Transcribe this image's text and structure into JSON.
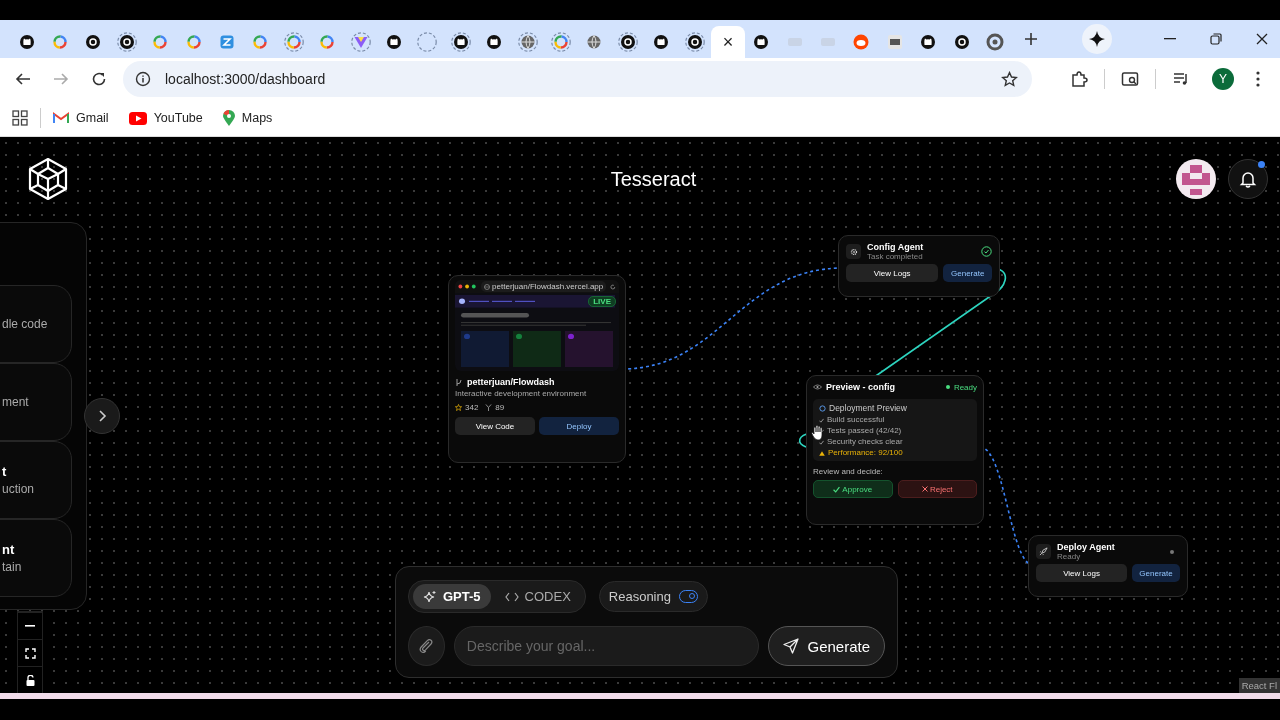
{
  "browser": {
    "tabs": [
      {
        "kind": "github",
        "selected": false,
        "loading": false
      },
      {
        "kind": "google",
        "selected": false,
        "loading": false
      },
      {
        "kind": "dark",
        "selected": false,
        "loading": false
      },
      {
        "kind": "dark",
        "selected": false,
        "loading": true
      },
      {
        "kind": "google",
        "selected": false,
        "loading": false
      },
      {
        "kind": "google",
        "selected": false,
        "loading": false
      },
      {
        "kind": "zed",
        "selected": false,
        "loading": false
      },
      {
        "kind": "google",
        "selected": false,
        "loading": false
      },
      {
        "kind": "google",
        "selected": false,
        "loading": true
      },
      {
        "kind": "google",
        "selected": false,
        "loading": false
      },
      {
        "kind": "vue",
        "selected": false,
        "loading": true
      },
      {
        "kind": "github",
        "selected": false,
        "loading": false
      },
      {
        "kind": "empty",
        "selected": false,
        "loading": true
      },
      {
        "kind": "github",
        "selected": false,
        "loading": true
      },
      {
        "kind": "github",
        "selected": false,
        "loading": false
      },
      {
        "kind": "globe",
        "selected": false,
        "loading": true
      },
      {
        "kind": "google",
        "selected": false,
        "loading": true
      },
      {
        "kind": "globe",
        "selected": false,
        "loading": false
      },
      {
        "kind": "dark",
        "selected": false,
        "loading": true
      },
      {
        "kind": "github",
        "selected": false,
        "loading": false
      },
      {
        "kind": "dark",
        "selected": false,
        "loading": true
      },
      {
        "selected": true,
        "close": "×"
      },
      {
        "kind": "github",
        "selected": false,
        "loading": false
      },
      {
        "kind": "faded",
        "selected": false,
        "loading": false
      },
      {
        "kind": "faded",
        "selected": false,
        "loading": false
      },
      {
        "kind": "reddit",
        "selected": false,
        "loading": false
      },
      {
        "kind": "square",
        "selected": false,
        "loading": false
      },
      {
        "kind": "github",
        "selected": false,
        "loading": false
      },
      {
        "kind": "dark",
        "selected": false,
        "loading": false
      },
      {
        "kind": "chrome",
        "selected": false,
        "loading": false
      }
    ],
    "address": "localhost:3000/dashboard",
    "profile_initial": "Y",
    "bookmarks": [
      {
        "label": "Gmail",
        "kind": "gmail"
      },
      {
        "label": "YouTube",
        "kind": "youtube"
      },
      {
        "label": "Maps",
        "kind": "maps"
      }
    ]
  },
  "app": {
    "title": "Tesseract",
    "unread_notifications": true
  },
  "sidebar": {
    "cards": [
      {
        "subtitle": "dle code"
      },
      {
        "subtitle": "ment"
      },
      {
        "title": "t",
        "subtitle": "uction"
      },
      {
        "title": "nt",
        "subtitle": "tain"
      }
    ]
  },
  "canvas": {
    "preview_node": {
      "url": "petterjuan/Flowdash.vercel.app",
      "badge": "LIVE",
      "repo": "petterjuan/Flowdash",
      "description": "Interactive development environment",
      "star_count": "342",
      "fork_count": "89",
      "actions": [
        "View Code",
        "Deploy"
      ]
    },
    "agents": [
      {
        "name": "Config Agent",
        "status": "Task completed",
        "kind": "config",
        "done": true,
        "actions": [
          "View Logs",
          "Generate"
        ]
      },
      {
        "name": "Deploy Agent",
        "status": "Ready",
        "kind": "deploy",
        "done": false,
        "actions": [
          "View Logs",
          "Generate"
        ]
      }
    ],
    "review_node": {
      "title": "Preview - config",
      "status": "Ready",
      "panel_title": "Deployment Preview",
      "checks": [
        {
          "text": "Build successful",
          "kind": "ok"
        },
        {
          "text": "Tests passed (42/42)",
          "kind": "ok"
        },
        {
          "text": "Security checks clear",
          "kind": "ok"
        },
        {
          "text": "Performance: 92/100",
          "kind": "warn"
        }
      ],
      "prompt": "Review and decide:",
      "approve": "Approve",
      "reject": "Reject"
    }
  },
  "composer": {
    "models": [
      {
        "label": "GPT-5",
        "kind": "sparkle",
        "selected": true
      },
      {
        "label": "CODEX",
        "kind": "code",
        "selected": false
      }
    ],
    "reasoning": {
      "label": "Reasoning",
      "on": true
    },
    "placeholder": "Describe your goal...",
    "submit": "Generate"
  },
  "attribution": "React Fl"
}
